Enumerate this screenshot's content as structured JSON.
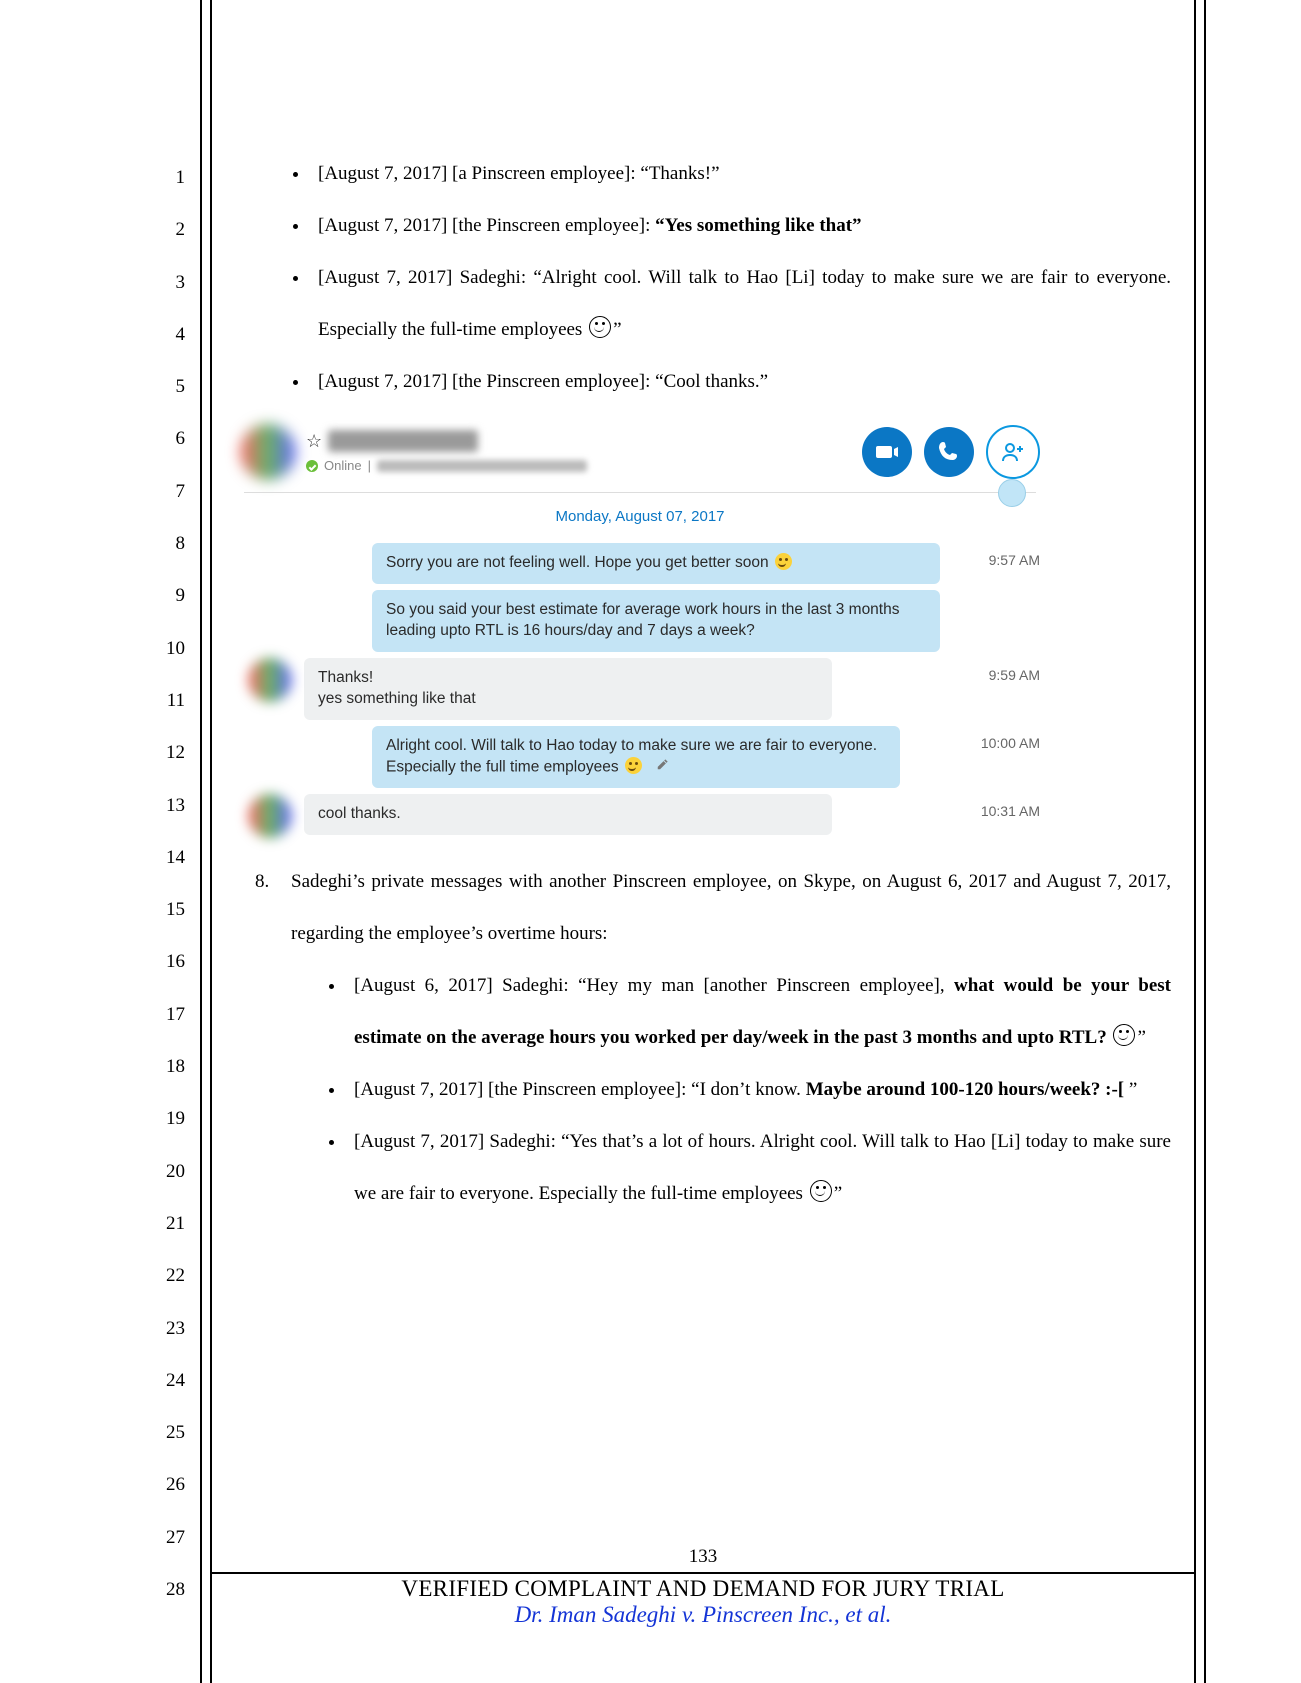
{
  "line_numbers": [
    "1",
    "2",
    "3",
    "4",
    "5",
    "6",
    "7",
    "8",
    "9",
    "10",
    "11",
    "12",
    "13",
    "14",
    "15",
    "16",
    "17",
    "18",
    "19",
    "20",
    "21",
    "22",
    "23",
    "24",
    "25",
    "26",
    "27",
    "28"
  ],
  "bullets_top": {
    "b1": "[August 7, 2017] [a Pinscreen employee]: “Thanks!”",
    "b2_pre": "[August 7, 2017] [the Pinscreen employee]: ",
    "b2_bold": "“Yes something like that”",
    "b3a": "[August 7, 2017] Sadeghi: “Alright cool. Will talk to Hao [Li] today to make sure we are fair to everyone. Especially the full-time employees ",
    "b3c": "”",
    "b4": "[August 7, 2017] [the Pinscreen employee]: “Cool thanks.”"
  },
  "skype": {
    "status": "Online",
    "sep": "|",
    "date": "Monday, August 07, 2017",
    "m1": "Sorry you are not feeling well. Hope you get better soon ",
    "m2": "So you said your best estimate for average work hours in the last 3 months leading upto RTL is 16 hours/day and 7 days a week?",
    "t1": "9:57 AM",
    "m3a": "Thanks!",
    "m3b": "yes something like that",
    "t3": "9:59 AM",
    "m4": "Alright cool. Will talk to Hao today to make sure we are fair to everyone. Especially the full time employees ",
    "t4": "10:00 AM",
    "m5": "cool thanks.",
    "t5": "10:31 AM"
  },
  "para8": {
    "num": "8.",
    "intro": "Sadeghi’s private messages with another Pinscreen employee, on Skype, on August 6, 2017 and August 7, 2017, regarding the employee’s overtime hours:",
    "b1a": "[August 6, 2017] Sadeghi: “Hey my man [another Pinscreen employee], ",
    "b1b": "what would be your best estimate on the average hours you worked per day/week in the past 3 months and upto RTL? ",
    "b1d": "”",
    "b2a": "[August 7, 2017] [the Pinscreen employee]: “I don’t know. ",
    "b2b": "Maybe around 100-120 hours/week? :-[ ",
    "b2c": "”",
    "b3a": "[August 7, 2017] Sadeghi: “Yes that’s a lot of hours. Alright cool. Will talk to Hao [Li] today to make sure we are fair to everyone. Especially the full-time employees ",
    "b3c": "”"
  },
  "footer": {
    "page": "133",
    "title": "VERIFIED COMPLAINT AND DEMAND FOR JURY TRIAL",
    "case": "Dr. Iman Sadeghi v. Pinscreen Inc., et al."
  }
}
